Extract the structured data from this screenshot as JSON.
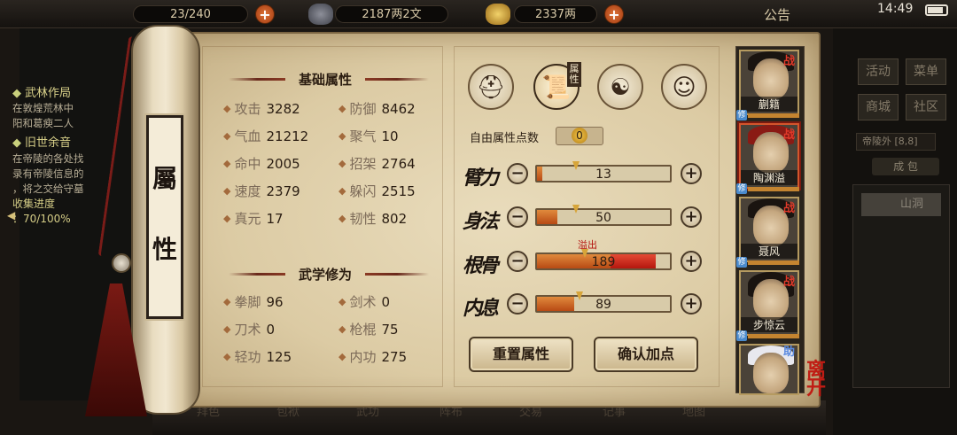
{
  "topbar": {
    "capacity": "23/240",
    "silver": "2187两2文",
    "gold": "2337两",
    "notice": "公告",
    "time": "14:49"
  },
  "left_panel": {
    "title1": "武林作局",
    "lines1": [
      "在敦煌荒林中",
      "阳和葛瘐二人"
    ],
    "title2": "旧世余音",
    "lines2": [
      "在帝陵的各处找",
      "录有帝陵信息的",
      "，将之交给守墓"
    ],
    "progress_label": "收集进度",
    "progress_value": "：70/100%"
  },
  "scroll_title": [
    "屬",
    "性"
  ],
  "basic": {
    "heading": "基础属性",
    "stats": [
      {
        "label": "攻击",
        "value": "3282"
      },
      {
        "label": "防御",
        "value": "8462"
      },
      {
        "label": "气血",
        "value": "21212"
      },
      {
        "label": "聚气",
        "value": "10"
      },
      {
        "label": "命中",
        "value": "2005"
      },
      {
        "label": "招架",
        "value": "2764"
      },
      {
        "label": "速度",
        "value": "2379"
      },
      {
        "label": "躲闪",
        "value": "2515"
      },
      {
        "label": "真元",
        "value": "17"
      },
      {
        "label": "韧性",
        "value": "802"
      }
    ]
  },
  "martial": {
    "heading": "武学修为",
    "stats": [
      {
        "label": "拳脚",
        "value": "96"
      },
      {
        "label": "剑术",
        "value": "0"
      },
      {
        "label": "刀术",
        "value": "0"
      },
      {
        "label": "枪棍",
        "value": "75"
      },
      {
        "label": "轻功",
        "value": "125"
      },
      {
        "label": "内功",
        "value": "275"
      }
    ]
  },
  "tabs": {
    "side_label": "属性",
    "icons": [
      "hat-icon",
      "scroll-book-icon",
      "yinyang-icon",
      "meridian-body-icon"
    ]
  },
  "free_points": {
    "label": "自由属性点数",
    "value": "0"
  },
  "attributes": [
    {
      "name": "臂力",
      "value": "13",
      "fill": 0.04
    },
    {
      "name": "身法",
      "value": "50",
      "fill": 0.15
    },
    {
      "name": "根骨",
      "value": "189",
      "fill": 0.55,
      "overflow": 0.34,
      "overflow_label": "溢出"
    },
    {
      "name": "内息",
      "value": "89",
      "fill": 0.28
    }
  ],
  "buttons": {
    "reset": "重置属性",
    "confirm": "确认加点"
  },
  "team": [
    {
      "name": "蒯籍",
      "tag": "战"
    },
    {
      "name": "陶渊溢",
      "tag": "战"
    },
    {
      "name": "聂风",
      "tag": "战"
    },
    {
      "name": "步惊云",
      "tag": "战"
    },
    {
      "name": "",
      "tag": "助"
    }
  ],
  "member_badge": "修",
  "leave_label": "离开",
  "right_bg": {
    "buttons": [
      "活动",
      "菜单",
      "商城",
      "社区"
    ],
    "location": "帝陵外",
    "location_coords": "[8,8]",
    "bag": "成 包",
    "cave": "山洞"
  },
  "bottom_items": [
    "拜色",
    "包袱",
    "武功",
    "阵布",
    "交易",
    "记事",
    "地图"
  ],
  "colors": {
    "accent_red": "#b3120e",
    "bar_fill": "#c8561c",
    "paper": "#e3d4b0"
  }
}
